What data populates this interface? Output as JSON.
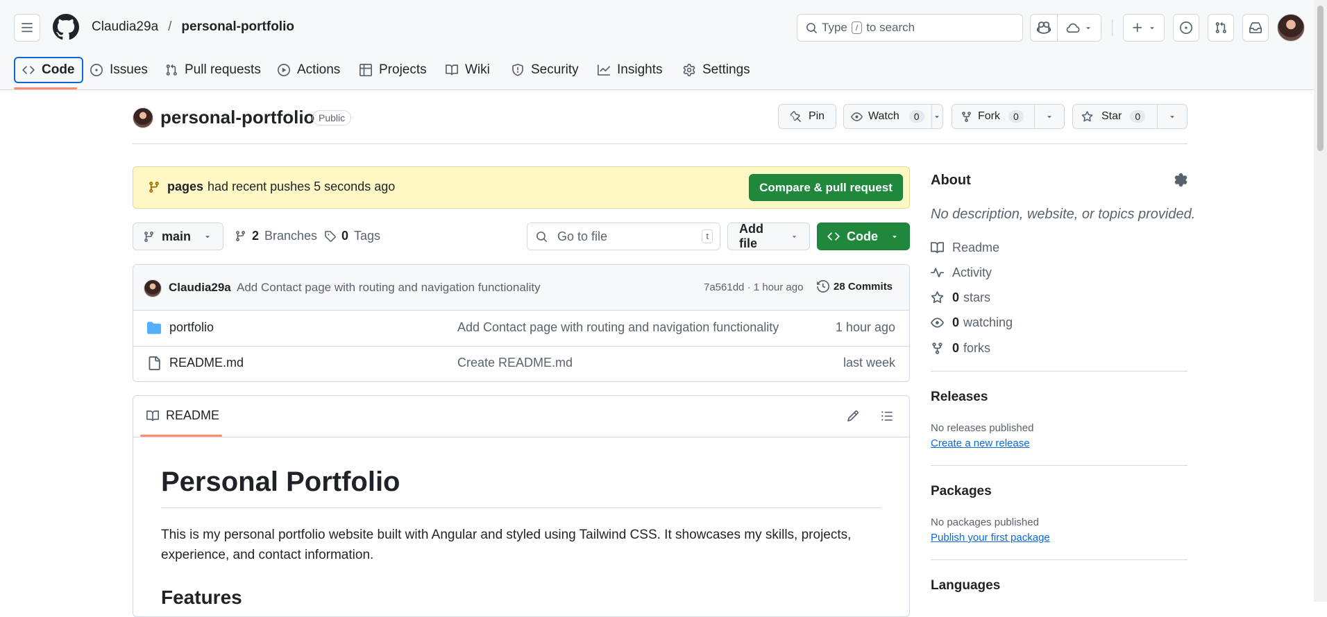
{
  "header": {
    "owner": "Claudia29a",
    "slash": "/",
    "repo": "personal-portfolio",
    "search_prefix": "Type",
    "search_key": "/",
    "search_suffix": "to search"
  },
  "tabs": [
    {
      "label": "Code",
      "icon": "code-icon"
    },
    {
      "label": "Issues",
      "icon": "issue-icon"
    },
    {
      "label": "Pull requests",
      "icon": "pull-request-icon"
    },
    {
      "label": "Actions",
      "icon": "play-icon"
    },
    {
      "label": "Projects",
      "icon": "table-icon"
    },
    {
      "label": "Wiki",
      "icon": "book-icon"
    },
    {
      "label": "Security",
      "icon": "shield-icon"
    },
    {
      "label": "Insights",
      "icon": "graph-icon"
    },
    {
      "label": "Settings",
      "icon": "gear-icon"
    }
  ],
  "repo": {
    "title": "personal-portfolio",
    "visibility": "Public",
    "pin": "Pin",
    "watch": "Watch",
    "watch_count": "0",
    "fork": "Fork",
    "fork_count": "0",
    "star": "Star",
    "star_count": "0"
  },
  "banner": {
    "branch": "pages",
    "text": "had recent pushes 5 seconds ago",
    "button": "Compare & pull request"
  },
  "toolbar": {
    "branch": "main",
    "branches_count": "2",
    "branches_label": "Branches",
    "tags_count": "0",
    "tags_label": "Tags",
    "goto_placeholder": "Go to file",
    "goto_key": "t",
    "add_file": "Add file",
    "code": "Code"
  },
  "commit": {
    "author": "Claudia29a",
    "message": "Add Contact page with routing and navigation functionality",
    "sha_time": "7a561dd · 1 hour ago",
    "commits": "28 Commits"
  },
  "files": [
    {
      "name": "portfolio",
      "type": "folder",
      "message": "Add Contact page with routing and navigation functionality",
      "time": "1 hour ago"
    },
    {
      "name": "README.md",
      "type": "file",
      "message": "Create README.md",
      "time": "last week"
    }
  ],
  "readme": {
    "tab": "README",
    "title": "Personal Portfolio",
    "body": "This is my personal portfolio website built with Angular and styled using Tailwind CSS. It showcases my skills, projects, experience, and contact information.",
    "features": "Features"
  },
  "about": {
    "heading": "About",
    "description": "No description, website, or topics provided.",
    "readme": "Readme",
    "activity": "Activity",
    "stars_count": "0",
    "stars_label": "stars",
    "watching_count": "0",
    "watching_label": "watching",
    "forks_count": "0",
    "forks_label": "forks"
  },
  "releases": {
    "heading": "Releases",
    "none": "No releases published",
    "link": "Create a new release"
  },
  "packages": {
    "heading": "Packages",
    "none": "No packages published",
    "link": "Publish your first package"
  },
  "languages": {
    "heading": "Languages"
  },
  "colors": {
    "accent": "#1f883d",
    "tab_underline": "#fd8c73",
    "link": "#0969da",
    "banner_bg": "#fff8c5",
    "folder": "#54aeff"
  }
}
